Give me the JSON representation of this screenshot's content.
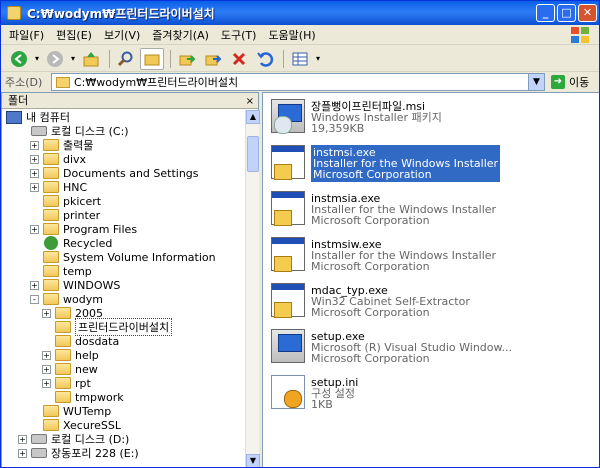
{
  "window": {
    "title": "C:₩wodym₩프린터드라이버설치"
  },
  "menu": [
    "파일(F)",
    "편집(E)",
    "보기(V)",
    "즐겨찾기(A)",
    "도구(T)",
    "도움말(H)"
  ],
  "address": {
    "label": "주소(D)",
    "value": "C:₩wodym₩프린터드라이버설치",
    "go_label": "이동"
  },
  "left_pane": {
    "header": "폴더",
    "close": "×"
  },
  "tree": [
    {
      "label": "내 컴퓨터",
      "icon": "computer-icon",
      "indent": 0,
      "pm": "none"
    },
    {
      "label": "로컬 디스크 (C:)",
      "icon": "drive-icon",
      "indent": 1,
      "pm": "none"
    },
    {
      "label": "출력물",
      "icon": "folder-icon",
      "indent": 2,
      "pm": "+"
    },
    {
      "label": "divx",
      "icon": "folder-icon",
      "indent": 2,
      "pm": "+"
    },
    {
      "label": "Documents and Settings",
      "icon": "folder-icon",
      "indent": 2,
      "pm": "+"
    },
    {
      "label": "HNC",
      "icon": "folder-icon",
      "indent": 2,
      "pm": "+"
    },
    {
      "label": "pkicert",
      "icon": "folder-icon",
      "indent": 2,
      "pm": ""
    },
    {
      "label": "printer",
      "icon": "folder-icon",
      "indent": 2,
      "pm": ""
    },
    {
      "label": "Program Files",
      "icon": "folder-icon",
      "indent": 2,
      "pm": "+"
    },
    {
      "label": "Recycled",
      "icon": "recycle-icon",
      "indent": 2,
      "pm": ""
    },
    {
      "label": "System Volume Information",
      "icon": "folder-icon",
      "indent": 2,
      "pm": ""
    },
    {
      "label": "temp",
      "icon": "folder-icon",
      "indent": 2,
      "pm": ""
    },
    {
      "label": "WINDOWS",
      "icon": "folder-icon",
      "indent": 2,
      "pm": "+"
    },
    {
      "label": "wodym",
      "icon": "folder-icon",
      "indent": 2,
      "pm": "-"
    },
    {
      "label": "2005",
      "icon": "folder-icon",
      "indent": 3,
      "pm": "+"
    },
    {
      "label": "프린터드라이버설치",
      "icon": "folder-icon",
      "indent": 3,
      "pm": "",
      "selected": true
    },
    {
      "label": "dosdata",
      "icon": "folder-icon",
      "indent": 3,
      "pm": ""
    },
    {
      "label": "help",
      "icon": "folder-icon",
      "indent": 3,
      "pm": "+"
    },
    {
      "label": "new",
      "icon": "folder-icon",
      "indent": 3,
      "pm": "+"
    },
    {
      "label": "rpt",
      "icon": "folder-icon",
      "indent": 3,
      "pm": "+"
    },
    {
      "label": "tmpwork",
      "icon": "folder-icon",
      "indent": 3,
      "pm": ""
    },
    {
      "label": "WUTemp",
      "icon": "folder-icon",
      "indent": 2,
      "pm": ""
    },
    {
      "label": "XecureSSL",
      "icon": "folder-icon",
      "indent": 2,
      "pm": ""
    },
    {
      "label": "로컬 디스크 (D:)",
      "icon": "drive-icon",
      "indent": 1,
      "pm": "+"
    },
    {
      "label": "장동포리 228 (E:)",
      "icon": "drive-icon",
      "indent": 1,
      "pm": "+"
    }
  ],
  "files": [
    {
      "name": "장플뻥이프린터파일.msi",
      "line2": "Windows Installer 패키지",
      "line3": "19,359KB",
      "icon": "msi-package-icon",
      "selected": false
    },
    {
      "name": "instmsi.exe",
      "line2": "Installer for the Windows Installer",
      "line3": "Microsoft Corporation",
      "icon": "installer-exe-icon",
      "selected": true
    },
    {
      "name": "instmsia.exe",
      "line2": "Installer for the Windows Installer",
      "line3": "Microsoft Corporation",
      "icon": "installer-exe-icon",
      "selected": false
    },
    {
      "name": "instmsiw.exe",
      "line2": "Installer for the Windows Installer",
      "line3": "Microsoft Corporation",
      "icon": "installer-exe-icon",
      "selected": false
    },
    {
      "name": "mdac_typ.exe",
      "line2": "Win32 Cabinet Self-Extractor",
      "line3": "Microsoft Corporation",
      "icon": "installer-exe-icon",
      "selected": false
    },
    {
      "name": "setup.exe",
      "line2": "Microsoft (R) Visual Studio Window...",
      "line3": "Microsoft Corporation",
      "icon": "setup-exe-icon",
      "selected": false
    },
    {
      "name": "setup.ini",
      "line2": "구성 설정",
      "line3": "1KB",
      "icon": "ini-file-icon",
      "selected": false
    }
  ]
}
